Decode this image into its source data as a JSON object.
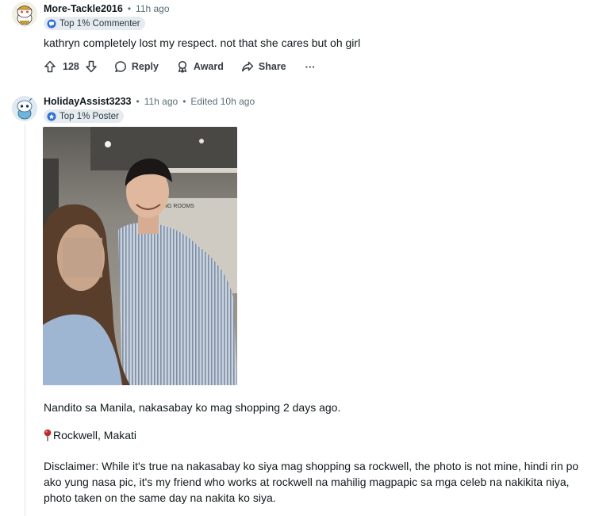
{
  "comment1": {
    "username": "More-Tackle2016",
    "time": "11h ago",
    "flair": "Top 1% Commenter",
    "text": "kathryn completely lost my respect. not that she cares but oh girl",
    "actions": {
      "score": "128",
      "reply": "Reply",
      "award": "Award",
      "share": "Share",
      "more": "···"
    }
  },
  "comment2": {
    "username": "HolidayAssist3233",
    "time": "11h ago",
    "edited": "Edited 10h ago",
    "flair": "Top 1% Poster",
    "paragraph1": "Nandito sa Manila, nakasabay ko mag shopping 2 days ago.",
    "location": "Rockwell, Makati",
    "disclaimer_line1": "Disclaimer: While it's true na nakasabay ko siya mag shopping sa rockwell, the photo is not mine, hindi rin po",
    "disclaimer_line2": "ako yung nasa pic, it's my friend who works at rockwell na mahilig magpapic sa mga celeb na nakikita niya,",
    "disclaimer_line3": "photo taken on the same day na nakita ko siya."
  },
  "colors": {
    "meta": "#576f76",
    "flair_bg": "#e5ebee",
    "thread_line": "#dfe3e5",
    "pin": "#c0282a"
  }
}
